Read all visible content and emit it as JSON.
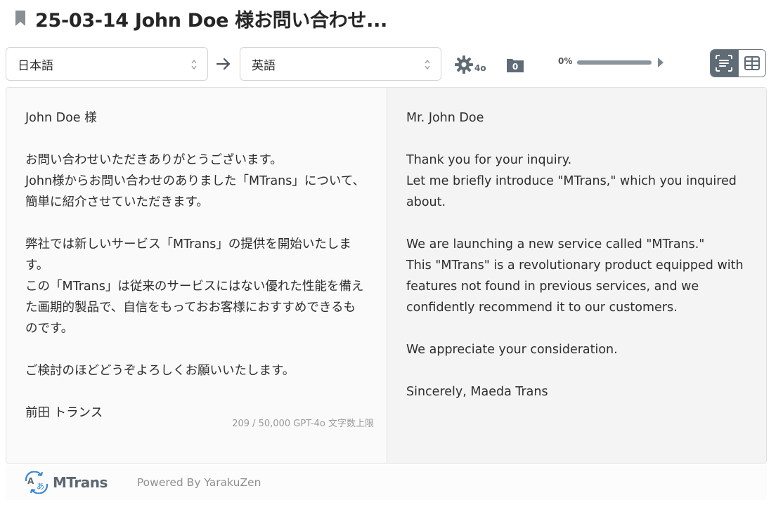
{
  "header": {
    "title": "25-03-14 John Doe 様お問い合わせ..."
  },
  "toolbar": {
    "source_language": "日本語",
    "target_language": "英語",
    "engine_sub": "4o",
    "folder_count": "0",
    "progress_label": "0%",
    "progress_percent": 0
  },
  "source": {
    "paragraphs": [
      "John Doe 様",
      "お問い合わせいただきありがとうございます。\nJohn様からお問い合わせのありました「MTrans」について、簡単に紹介させていただきます。",
      "弊社では新しいサービス「MTrans」の提供を開始いたします。\nこの「MTrans」は従来のサービスにはない優れた性能を備えた画期的製品で、自信をもっておお客様におすすめできるものです。",
      "ご検討のほどどうぞよろしくお願いいたします。",
      "前田 トランス"
    ],
    "char_count": "209 / 50,000 GPT-4o 文字数上限"
  },
  "translation": {
    "paragraphs": [
      "Mr. John Doe",
      "Thank you for your inquiry.\nLet me briefly introduce \"MTrans,\" which you inquired about.",
      "We are launching a new service called \"MTrans.\"\nThis \"MTrans\" is a revolutionary product equipped with features not found in previous services, and we confidently recommend it to our customers.",
      "We appreciate your consideration.",
      "Sincerely, Maeda Trans"
    ]
  },
  "footer": {
    "logo_text": "MTrans",
    "logo_badge_a": "A",
    "logo_badge_b": "あ",
    "powered_by": "Powered By YarakuZen"
  },
  "colors": {
    "icon_gray": "#5f6b75",
    "accent_blue": "#4e8de0"
  }
}
